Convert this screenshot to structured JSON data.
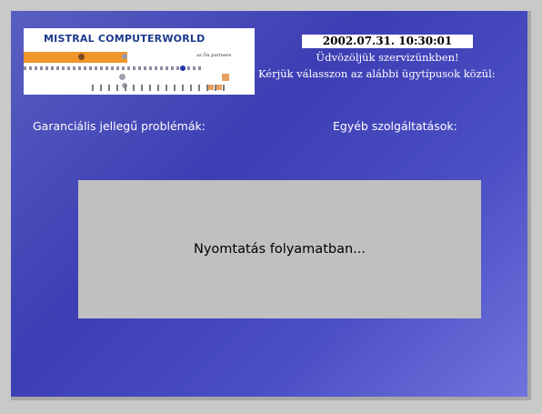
{
  "logo": {
    "title": "MISTRAL COMPUTERWORLD",
    "tagline": "az Ön partnere"
  },
  "header": {
    "datetime": "2002.07.31. 10:30:01",
    "welcome": "Üdvözöljük szervizünkben!",
    "instruction": "Kérjük válasszon az alábbi ügytípusok közül:"
  },
  "categories": {
    "warranty": "Garanciális jellegű problémák:",
    "other": "Egyéb szolgáltatások:"
  },
  "dialog": {
    "message": "Nyomtatás folyamatban..."
  },
  "colors": {
    "background": "#3d3eb4",
    "dialog": "#c0c0c0",
    "logo_accent": "#f0962a",
    "logo_text": "#1d3a8e"
  }
}
